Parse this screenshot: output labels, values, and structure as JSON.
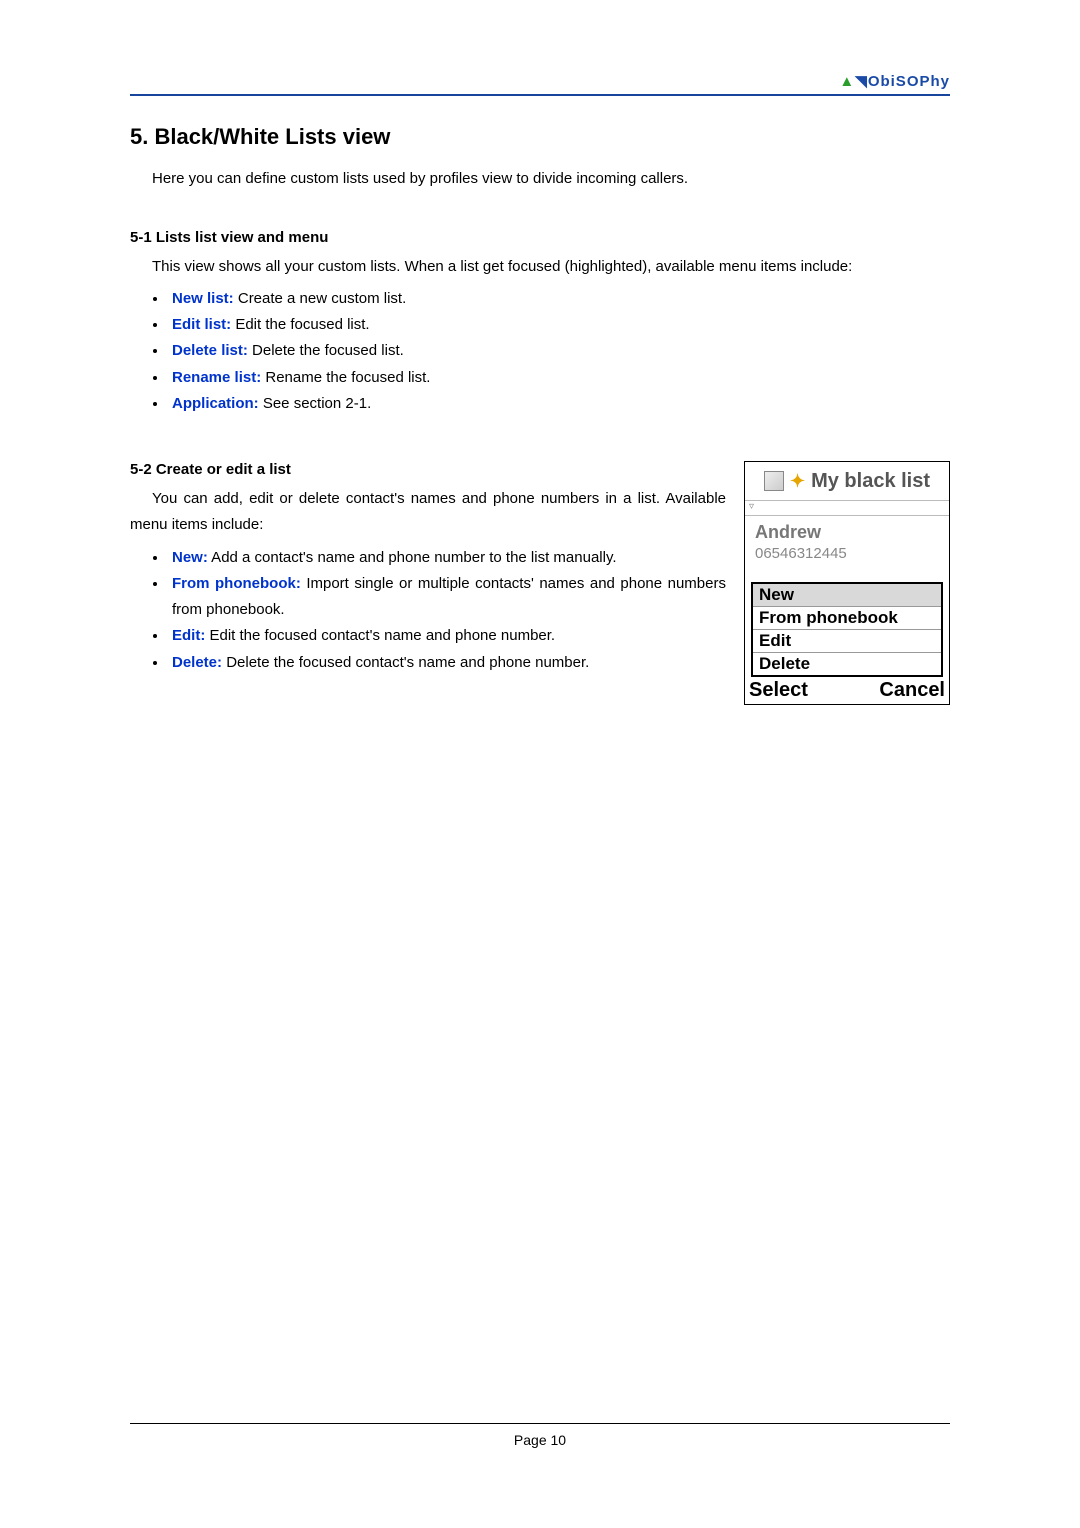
{
  "brand": "ObiSOPhy",
  "section_title": "5. Black/White Lists view",
  "intro": "Here you can define custom lists used by profiles view to divide incoming callers.",
  "s51": {
    "heading": "5-1 Lists list view and menu",
    "para": "This view shows all your custom lists. When a list get focused (highlighted), available menu items include:",
    "items": [
      {
        "k": "New list:",
        "v": " Create a new custom list."
      },
      {
        "k": "Edit list:",
        "v": " Edit the focused list."
      },
      {
        "k": "Delete list:",
        "v": " Delete the focused list."
      },
      {
        "k": "Rename list:",
        "v": " Rename the focused list."
      },
      {
        "k": "Application:",
        "v": " See section 2-1."
      }
    ]
  },
  "s52": {
    "heading": "5-2 Create or edit a list",
    "para": "You can add, edit or delete contact's names and phone numbers in a list. Available menu items include:",
    "items": [
      {
        "k": "New:",
        "v": " Add a contact's name and phone number to the list manually."
      },
      {
        "k": "From phonebook:",
        "v": " Import single or multiple contacts' names and phone numbers from phonebook."
      },
      {
        "k": "Edit:",
        "v": " Edit the focused contact's name and phone number."
      },
      {
        "k": "Delete:",
        "v": " Delete the focused contact's name and phone number."
      }
    ]
  },
  "phone": {
    "title": "My black list",
    "contact_name": "Andrew",
    "contact_number": "06546312445",
    "menu": [
      "New",
      "From phonebook",
      "Edit",
      "Delete"
    ],
    "soft_left": "Select",
    "soft_right": "Cancel"
  },
  "page_label": "Page 10"
}
